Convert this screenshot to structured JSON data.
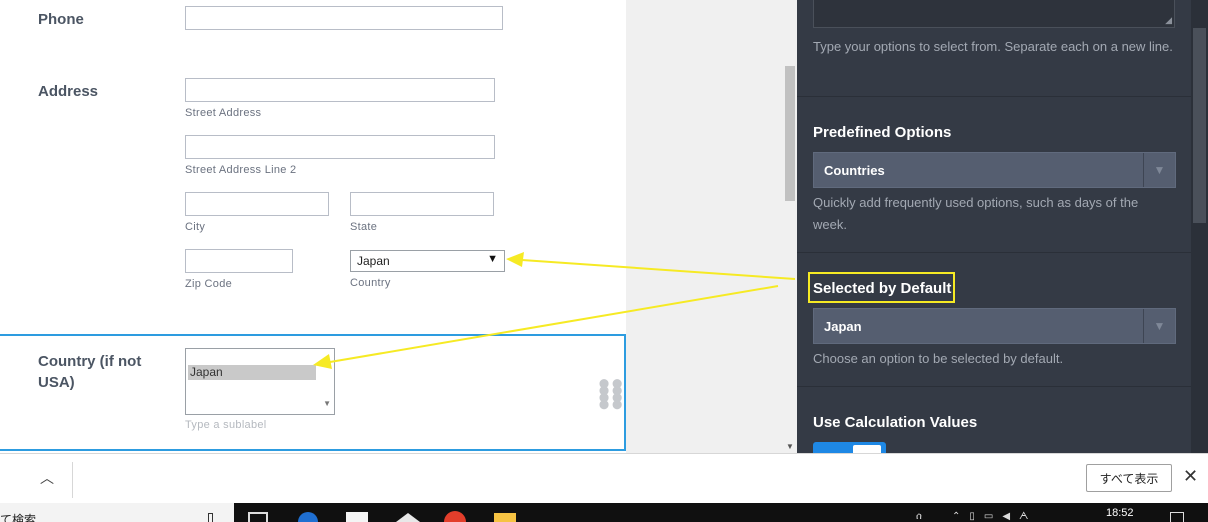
{
  "form": {
    "phone_label": "Phone",
    "address_label": "Address",
    "street_sublabel": "Street Address",
    "street2_sublabel": "Street Address Line 2",
    "city_sublabel": "City",
    "state_sublabel": "State",
    "zip_sublabel": "Zip Code",
    "country_sublabel": "Country",
    "country_select_value": "Japan",
    "country_field_label": "Country (if not USA)",
    "listbox_selected": "Japan",
    "listbox_sublabel_placeholder": "Type a sublabel"
  },
  "panel": {
    "options_help": "Type your options to select from. Separate each on a new line.",
    "predefined_title": "Predefined Options",
    "predefined_value": "Countries",
    "predefined_help": "Quickly add frequently used options, such as days of the week.",
    "default_title": "Selected by Default",
    "default_value": "Japan",
    "default_help": "Choose an option to be selected by default.",
    "calc_title": "Use Calculation Values"
  },
  "download_bar": {
    "show_all_label": "すべて表示"
  },
  "taskbar": {
    "search_text": "て検索",
    "time": "18:52"
  },
  "colors": {
    "panel_bg": "#343a45",
    "accent_blue": "#2d9ce0",
    "highlight_yellow": "#f6ea24",
    "delete_red": "#d93025",
    "toggle_blue": "#1e88e5"
  }
}
